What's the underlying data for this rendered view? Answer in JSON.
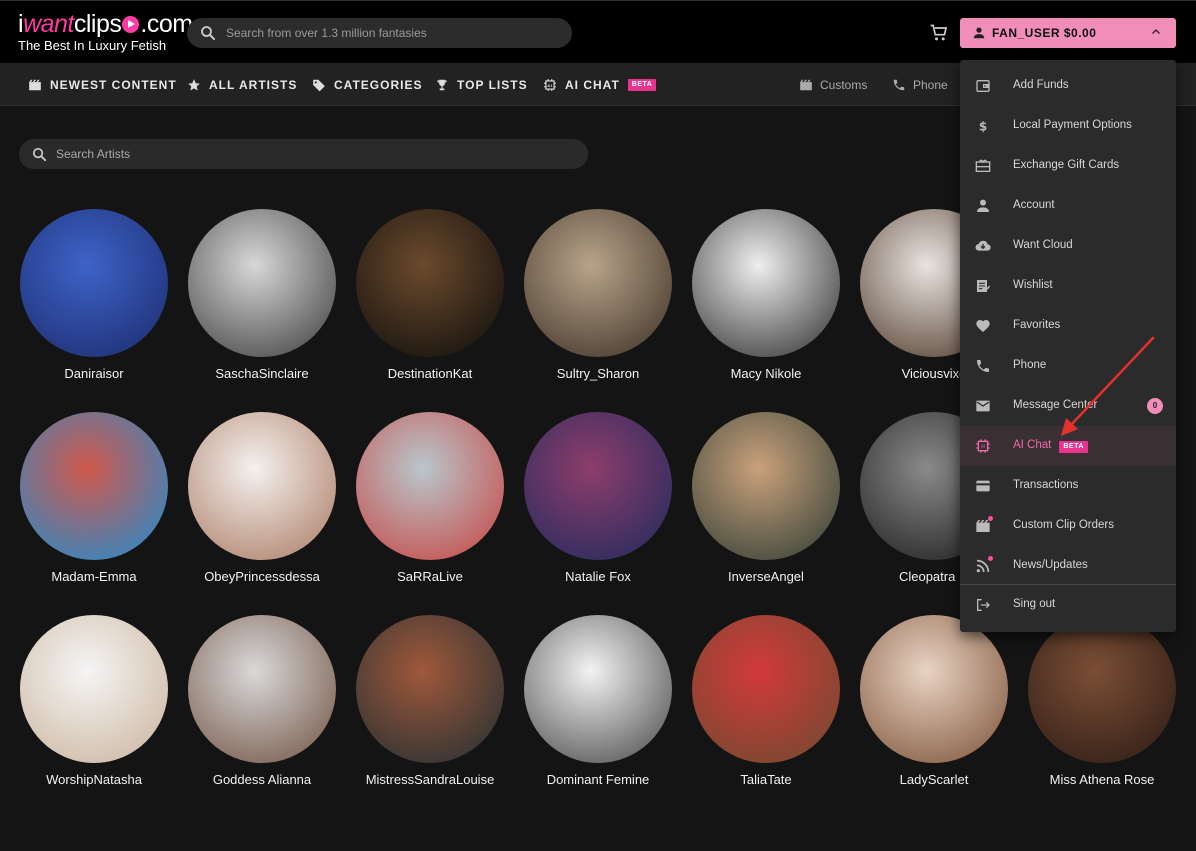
{
  "header": {
    "logo_prefix": "i",
    "logo_want": "want",
    "logo_clips": "clips",
    "logo_suffix": ".com",
    "tagline": "The Best In Luxury Fetish",
    "search_placeholder": "Search from over 1.3 million fantasies",
    "user_label": "FAN_USER $0.00"
  },
  "nav": {
    "items": [
      {
        "label": "NEWEST CONTENT",
        "icon": "film-icon"
      },
      {
        "label": "ALL ARTISTS",
        "icon": "star-icon"
      },
      {
        "label": "CATEGORIES",
        "icon": "tag-icon"
      },
      {
        "label": "TOP LISTS",
        "icon": "trophy-icon"
      },
      {
        "label": "AI CHAT",
        "icon": "chip-icon",
        "badge": "BETA"
      }
    ],
    "right": [
      {
        "label": "Customs",
        "icon": "film-icon"
      },
      {
        "label": "Phone",
        "icon": "phone-icon"
      }
    ]
  },
  "artists_search": {
    "placeholder": "Search Artists"
  },
  "artists": [
    {
      "name": "Daniraisor",
      "colors": [
        "#3d63c9",
        "#1c2a6a"
      ]
    },
    {
      "name": "SaschaSinclaire",
      "colors": [
        "#d8d8d8",
        "#3a3a3a"
      ]
    },
    {
      "name": "DestinationKat",
      "colors": [
        "#6b4a2c",
        "#0c0c0c"
      ]
    },
    {
      "name": "Sultry_Sharon",
      "colors": [
        "#b9a48a",
        "#3a2f25"
      ]
    },
    {
      "name": "Macy Nikole",
      "colors": [
        "#efefef",
        "#2a2a2a"
      ]
    },
    {
      "name": "Viciousvixe",
      "colors": [
        "#e9e4df",
        "#4a3426"
      ]
    },
    {
      "name": "Madam-Emma",
      "colors": [
        "#d0584b",
        "#1b8fd4"
      ]
    },
    {
      "name": "ObeyPrincessdessa",
      "colors": [
        "#f4f1ef",
        "#a9785f"
      ]
    },
    {
      "name": "SaRRaLive",
      "colors": [
        "#b9c7cc",
        "#c7413e"
      ]
    },
    {
      "name": "Natalie Fox",
      "colors": [
        "#8d3d6b",
        "#1d2a5c"
      ]
    },
    {
      "name": "InverseAngel",
      "colors": [
        "#c9a17b",
        "#2c3a33"
      ]
    },
    {
      "name": "Cleopatra Is",
      "colors": [
        "#8a8a8a",
        "#1a1a1a"
      ]
    },
    {
      "name": "WorshipNatasha",
      "colors": [
        "#f5f5f5",
        "#c9b29a"
      ]
    },
    {
      "name": "Goddess Alianna",
      "colors": [
        "#d9d9d9",
        "#6f5040"
      ]
    },
    {
      "name": "MistressSandraLouise",
      "colors": [
        "#a0583a",
        "#1e2e33"
      ]
    },
    {
      "name": "Dominant Femine",
      "colors": [
        "#f3f3f3",
        "#444444"
      ]
    },
    {
      "name": "TaliaTate",
      "colors": [
        "#d23a3a",
        "#6b4a30"
      ]
    },
    {
      "name": "LadyScarlet",
      "colors": [
        "#e9d3c3",
        "#7a5035"
      ]
    },
    {
      "name": "Miss Athena Rose",
      "colors": [
        "#7b4e35",
        "#2a1a14"
      ]
    }
  ],
  "menu": {
    "items": [
      {
        "label": "Add Funds",
        "icon": "wallet-icon"
      },
      {
        "label": "Local Payment Options",
        "icon": "dollar-icon"
      },
      {
        "label": "Exchange Gift Cards",
        "icon": "gift-card-icon"
      },
      {
        "label": "Account",
        "icon": "person-icon"
      },
      {
        "label": "Want Cloud",
        "icon": "cloud-download-icon"
      },
      {
        "label": "Wishlist",
        "icon": "playlist-add-icon"
      },
      {
        "label": "Favorites",
        "icon": "heart-icon"
      },
      {
        "label": "Phone",
        "icon": "phone-icon"
      },
      {
        "label": "Message Center",
        "icon": "mail-icon",
        "count": "0"
      },
      {
        "label": "AI Chat",
        "icon": "chip-icon",
        "badge": "BETA",
        "active": true
      },
      {
        "label": "Transactions",
        "icon": "credit-card-icon"
      },
      {
        "label": "Custom Clip Orders",
        "icon": "film-icon",
        "dot": true
      },
      {
        "label": "News/Updates",
        "icon": "rss-icon",
        "dot": true
      },
      {
        "label": "Sing out",
        "icon": "logout-icon"
      }
    ]
  },
  "colors": {
    "accent_pink": "#f08db8",
    "beta_pink": "#e9338f",
    "annotation_arrow": "#e53030"
  }
}
